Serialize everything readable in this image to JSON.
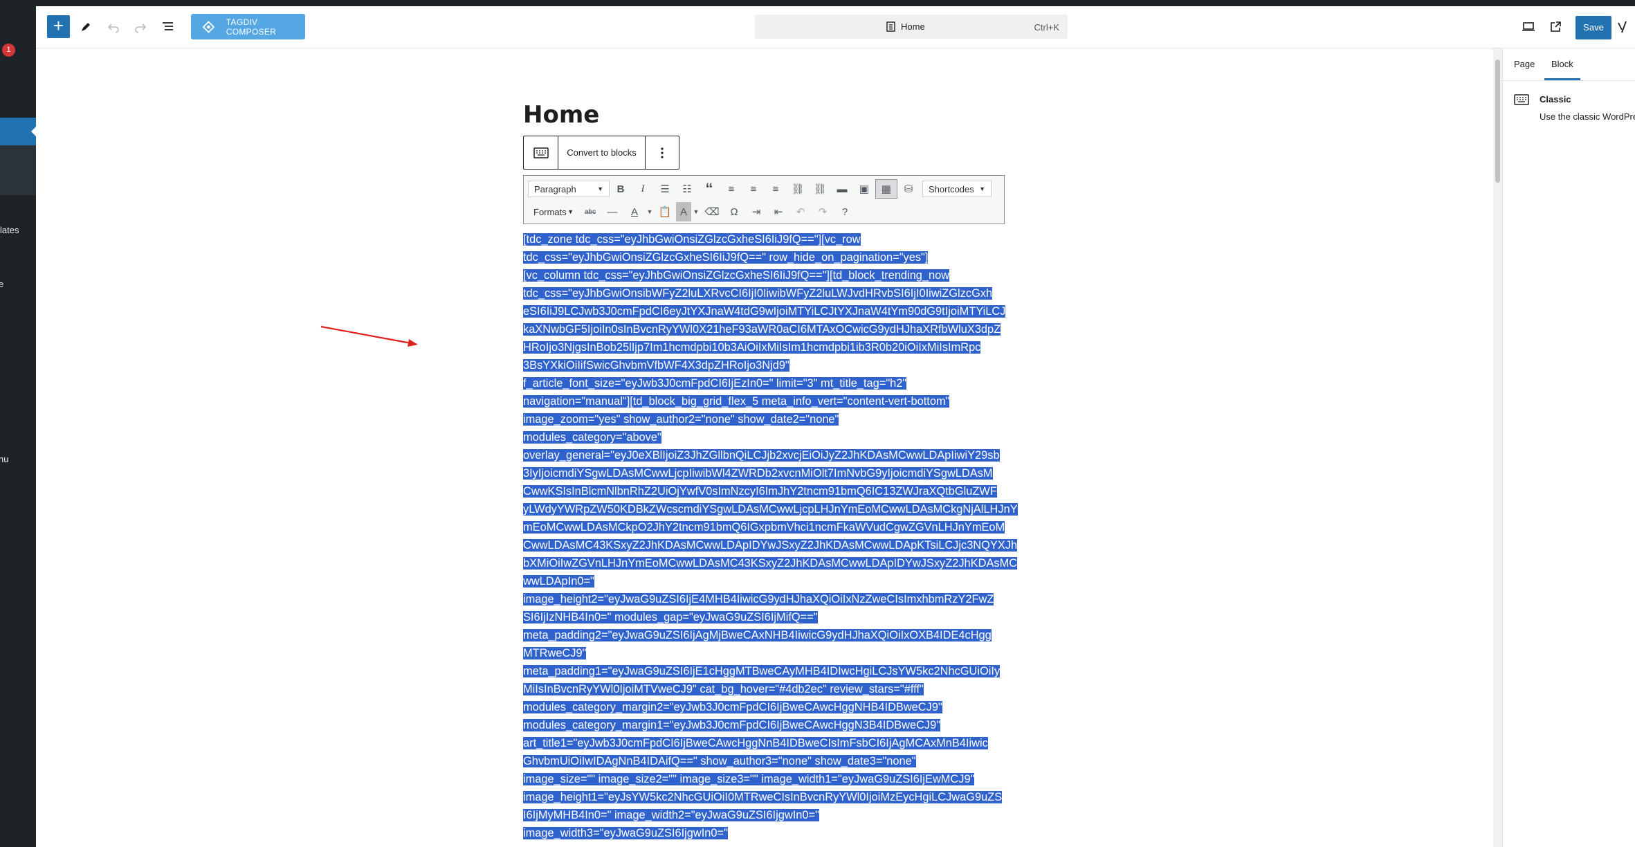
{
  "admin_sidebar": {
    "update_badge": "1",
    "items": [
      "lates",
      "e",
      "nu"
    ]
  },
  "header": {
    "add_label": "+",
    "composer_label": "TAGDIV COMPOSER",
    "document_title": "Home",
    "command_shortcut": "Ctrl+K",
    "save_label": "Save"
  },
  "settings": {
    "tabs": [
      "Page",
      "Block"
    ],
    "active_tab": "Block",
    "block_name": "Classic",
    "block_description": "Use the classic WordPress editor."
  },
  "editor": {
    "page_title": "Home",
    "convert_label": "Convert to blocks",
    "format_select": "Paragraph",
    "formats_select": "Formats",
    "shortcodes_select": "Shortcodes",
    "content_lines": [
      "[tdc_zone tdc_css=\"eyJhbGwiOnsiZGlzcGxheSI6IiJ9fQ==\"][vc_row",
      "tdc_css=\"eyJhbGwiOnsiZGlzcGxheSI6IiJ9fQ==\" row_hide_on_pagination=\"yes\"]",
      "[vc_column tdc_css=\"eyJhbGwiOnsiZGlzcGxheSI6IiJ9fQ==\"][td_block_trending_now",
      "tdc_css=\"eyJhbGwiOnsibWFyZ2luLXRvcCI6IjI0IiwibWFyZ2luLWJvdHRvbSI6IjI0IiwiZGlzcGxh",
      "eSI6IiJ9LCJwb3J0cmFpdCI6eyJtYXJnaW4tdG9wIjoiMTYiLCJtYXJnaW4tYm90dG9tIjoiMTYiLCJ",
      "kaXNwbGF5IjoiIn0sInBvcnRyYWl0X21heF93aWR0aCI6MTAxOCwicG9ydHJhaXRfbWluX3dpZ",
      "HRoIjo3NjgsInBob25lIjp7Im1hcmdpbi10b3AiOiIxMiIsIm1hcmdpbi1ib3R0b20iOiIxMiIsImRpc",
      "3BsYXkiOiIifSwicGhvbmVfbWF4X3dpZHRoIjo3Njd9\"",
      "f_article_font_size=\"eyJwb3J0cmFpdCI6IjEzIn0=\" limit=\"3\" mt_title_tag=\"h2\"",
      "navigation=\"manual\"][td_block_big_grid_flex_5 meta_info_vert=\"content-vert-bottom\"",
      "image_zoom=\"yes\" show_author2=\"none\" show_date2=\"none\"",
      "modules_category=\"above\"",
      "overlay_general=\"eyJ0eXBlIjoiZ3JhZGllbnQiLCJjb2xvcjEiOiJyZ2JhKDAsMCwwLDApIiwiY29sb",
      "3IyIjoicmdiYSgwLDAsMCwwLjcpIiwibWl4ZWRDb2xvcnMiOlt7ImNvbG9yIjoicmdiYSgwLDAsM",
      "CwwKSIsInBlcmNlbnRhZ2UiOjYwfV0sImNzcyI6ImJhY2tncm91bmQ6IC13ZWJraXQtbGluZWF",
      "yLWdyYWRpZW50KDBkZWcscmdiYSgwLDAsMCwwLjcpLHJnYmEoMCwwLDAsMCkgNjAlLHJnY",
      "mEoMCwwLDAsMCkpO2JhY2tncm91bmQ6IGxpbmVhci1ncmFkaWVudCgwZGVnLHJnYmEoM",
      "CwwLDAsMC43KSxyZ2JhKDAsMCwwLDApIDYwJSxyZ2JhKDAsMCwwLDApKTsiLCJjc3NQYXJh",
      "bXMiOiIwZGVnLHJnYmEoMCwwLDAsMC43KSxyZ2JhKDAsMCwwLDApIDYwJSxyZ2JhKDAsMC",
      "wwLDApIn0=\"",
      "image_height2=\"eyJwaG9uZSI6IjE4MHB4IiwicG9ydHJhaXQiOiIxNzZweCIsImxhbmRzY2FwZ",
      "SI6IjIzNHB4In0=\" modules_gap=\"eyJwaG9uZSI6IjMifQ==\"",
      "meta_padding2=\"eyJwaG9uZSI6IjAgMjBweCAxNHB4IiwicG9ydHJhaXQiOiIxOXB4IDE4cHgg",
      "MTRweCJ9\"",
      "meta_padding1=\"eyJwaG9uZSI6IjE1cHggMTBweCAyMHB4IDIwcHgiLCJsYW5kc2NhcGUiOiIy",
      "MiIsInBvcnRyYWl0IjoiMTVweCJ9\" cat_bg_hover=\"#4db2ec\" review_stars=\"#fff\"",
      "modules_category_margin2=\"eyJwb3J0cmFpdCI6IjBweCAwcHggNHB4IDBweCJ9\"",
      "modules_category_margin1=\"eyJwb3J0cmFpdCI6IjBweCAwcHggN3B4IDBweCJ9\"",
      "art_title1=\"eyJwb3J0cmFpdCI6IjBweCAwcHggNnB4IDBweCIsImFsbCI6IjAgMCAxMnB4Iiwic",
      "GhvbmUiOiIwIDAgNnB4IDAifQ==\" show_author3=\"none\" show_date3=\"none\"",
      "image_size=\"\" image_size2=\"\" image_size3=\"\" image_width1=\"eyJwaG9uZSI6IjEwMCJ9\"",
      "image_height1=\"eyJsYW5kc2NhcGUiOiI0MTRweCIsInBvcnRyYWl0IjoiMzEycHgiLCJwaG9uZS",
      "I6IjMyMHB4In0=\" image_width2=\"eyJwaG9uZSI6IjgwIn0=\"",
      "image_width3=\"eyJwaG9uZSI6IjgwIn0=\""
    ]
  }
}
